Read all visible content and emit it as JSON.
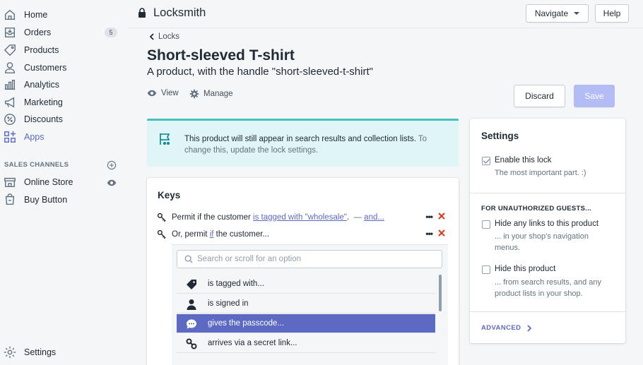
{
  "sidebar": {
    "items": [
      {
        "label": "Home",
        "icon": "home-icon"
      },
      {
        "label": "Orders",
        "icon": "orders-icon",
        "badge": "5"
      },
      {
        "label": "Products",
        "icon": "tag-icon"
      },
      {
        "label": "Customers",
        "icon": "person-icon"
      },
      {
        "label": "Analytics",
        "icon": "bar-chart-icon"
      },
      {
        "label": "Marketing",
        "icon": "megaphone-icon"
      },
      {
        "label": "Discounts",
        "icon": "discount-icon"
      },
      {
        "label": "Apps",
        "icon": "apps-icon"
      }
    ],
    "sales_channels_heading": "SALES CHANNELS",
    "channels": [
      {
        "label": "Online Store",
        "icon": "store-icon"
      },
      {
        "label": "Buy Button",
        "icon": "buy-button-icon"
      }
    ],
    "settings_label": "Settings"
  },
  "topbar": {
    "title": "Locksmith",
    "navigate_label": "Navigate",
    "help_label": "Help"
  },
  "page": {
    "back_label": "Locks",
    "title": "Short-sleeved T-shirt",
    "subtitle": "A product, with the handle \"short-sleeved-t-shirt\"",
    "view_label": "View",
    "manage_label": "Manage",
    "discard_label": "Discard",
    "save_label": "Save"
  },
  "banner": {
    "text": "This product will still appear in search results and collection lists.",
    "link_text": "To change this, update the lock settings."
  },
  "keys": {
    "title": "Keys",
    "row1": {
      "prefix": "Permit if the customer",
      "condition": "is tagged with \"wholesale\"",
      "suffix": ".",
      "dash": "—",
      "and": "and..."
    },
    "row2": {
      "prefix": "Or, permit",
      "if": "if",
      "suffix": "the customer..."
    },
    "more": "•••"
  },
  "dropdown": {
    "search_placeholder": "Search or scroll for an option",
    "options": [
      {
        "label": "is tagged with...",
        "icon": "tag-icon"
      },
      {
        "label": "is signed in",
        "icon": "person-icon"
      },
      {
        "label": "gives the passcode...",
        "icon": "chat-bubble-icon",
        "selected": true
      },
      {
        "label": "arrives via a secret link...",
        "icon": "link-icon"
      }
    ]
  },
  "settings": {
    "title": "Settings",
    "enable_label": "Enable this lock",
    "enable_help": "The most important part. :)",
    "enable_checked": true,
    "guests_heading": "FOR UNAUTHORIZED GUESTS...",
    "hide_links_label": "Hide any links to this product",
    "hide_links_help": "... in your shop's navigation menus.",
    "hide_product_label": "Hide this product",
    "hide_product_help": "... from search results, and any product lists in your shop.",
    "advanced_label": "ADVANCED"
  },
  "colors": {
    "accent": "#5c6ac4",
    "banner_bg": "#e0f5f5",
    "banner_border": "#47c1bf",
    "danger": "#de3618",
    "save_disabled": "#b3bcf5"
  }
}
